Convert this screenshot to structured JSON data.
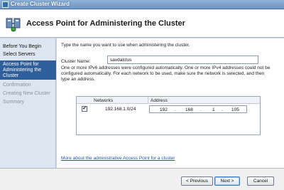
{
  "window": {
    "title": "Create Cluster Wizard",
    "icon": "cluster-wizard-icon"
  },
  "header": {
    "title": "Access Point for Administering the Cluster",
    "icon": "cluster-access-point-icon"
  },
  "sidebar": {
    "items": [
      {
        "label": "Before You Begin",
        "state": "normal"
      },
      {
        "label": "Select Servers",
        "state": "normal"
      },
      {
        "label": "Access Point for Administering the Cluster",
        "state": "active"
      },
      {
        "label": "Confirmation",
        "state": "disabled"
      },
      {
        "label": "Creating New Cluster",
        "state": "disabled"
      },
      {
        "label": "Summary",
        "state": "disabled"
      }
    ]
  },
  "main": {
    "instruction": "Type the name you want to use when administering the cluster.",
    "cluster_name_label": "Cluster Name:",
    "cluster_name_value": "savdalclus",
    "info_text": "One or more IPv6 addresses were configured automatically.  One or more IPv4 addresses could not be configured automatically.  For each network to be used, make sure the network is selected, and then type an address.",
    "grid": {
      "columns": [
        "Networks",
        "Address"
      ],
      "rows": [
        {
          "checked": true,
          "check_glyph": "✔",
          "network": "192.168.1.0/24",
          "address": [
            "192",
            "168",
            "1",
            "105"
          ]
        }
      ]
    },
    "more_link": "More about the administrative Access Point for a cluster"
  },
  "footer": {
    "previous": "< Previous",
    "next": "Next >",
    "cancel": "Cancel"
  },
  "colors": {
    "active_nav": "#2e5f9a",
    "link": "#2456a8",
    "titlebar": "#7ea4cf"
  }
}
